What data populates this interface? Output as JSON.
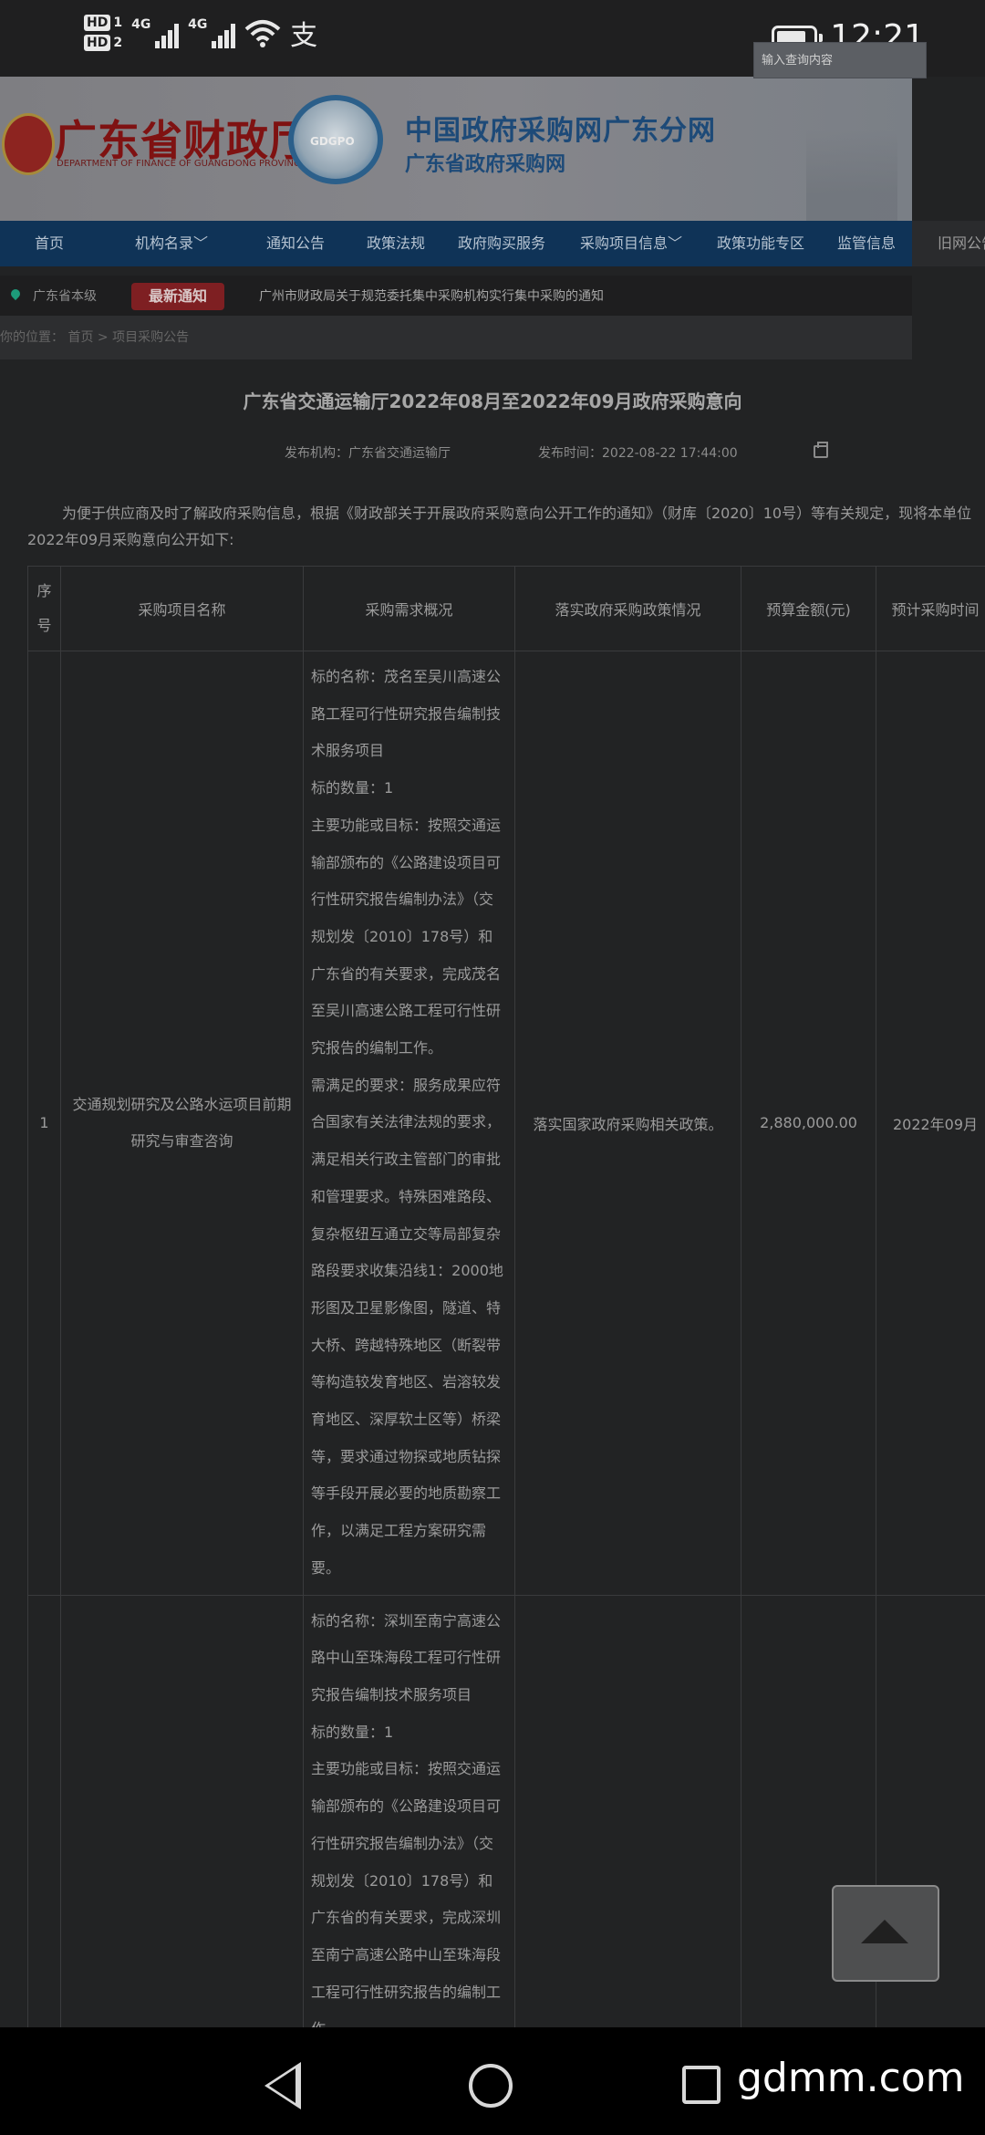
{
  "status_bar": {
    "sim1": "HD",
    "sim1_num": "1",
    "sim2": "HD",
    "sim2_num": "2",
    "network1": "4G",
    "network2": "4G",
    "extra_icon": "支",
    "battery_level": 0.8,
    "time": "12:21"
  },
  "header": {
    "logo_text": "广东省财政厅",
    "logo_sub": "DEPARTMENT OF FINANCE OF GUANGDONG PROVINCE",
    "badge_text": "GDGPO",
    "site_title": "中国政府采购网广东分网",
    "site_subtitle": "广东省政府采购网",
    "search_placeholder": "输入查询内容"
  },
  "nav": {
    "items": [
      {
        "label": "首页"
      },
      {
        "label": "机构名录﹀"
      },
      {
        "label": "通知公告"
      },
      {
        "label": "政策法规"
      },
      {
        "label": "政府购买服务"
      },
      {
        "label": "采购项目信息﹀"
      },
      {
        "label": "政策功能专区"
      },
      {
        "label": "监管信息"
      },
      {
        "label": "旧网公告"
      }
    ]
  },
  "notice": {
    "region": "广东省本级",
    "badge": "最新通知",
    "text": "广州市财政局关于规范委托集中采购机构实行集中采购的通知"
  },
  "breadcrumb": {
    "text": "你的位置： 首页 > 项目采购公告"
  },
  "article": {
    "title": "广东省交通运输厅2022年08月至2022年09月政府采购意向",
    "publisher": "发布机构：广东省交通运输厅",
    "publish_time": "发布时间：2022-08-22 17:44:00",
    "intro": "为便于供应商及时了解政府采购信息，根据《财政部关于开展政府采购意向公开工作的通知》（财库〔2020〕10号）等有关规定，现将本单位2022年09月采购意向公开如下:"
  },
  "table": {
    "headers": [
      "序号",
      "采购项目名称",
      "采购需求概况",
      "落实政府采购政策情况",
      "预算金额(元)",
      "预计采购时间"
    ],
    "rows": [
      {
        "index": "1",
        "name": "交通规划研究及公路水运项目前期研究与审查咨询",
        "requirement": "标的名称：茂名至吴川高速公路工程可行性研究报告编制技术服务项目\n标的数量：1\n主要功能或目标：按照交通运输部颁布的《公路建设项目可行性研究报告编制办法》（交规划发〔2010〕178号）和广东省的有关要求，完成茂名至吴川高速公路工程可行性研究报告的编制工作。\n需满足的要求：服务成果应符合国家有关法律法规的要求，满足相关行政主管部门的审批和管理要求。特殊困难路段、复杂枢纽互通立交等局部复杂路段要求收集沿线1：2000地形图及卫星影像图，隧道、特大桥、跨越特殊地区（断裂带等构造较发育地区、岩溶较发育地区、深厚软土区等）桥梁等，要求通过物探或地质钻探等手段开展必要的地质勘察工作，以满足工程方案研究需要。",
        "policy": "落实国家政府采购相关政策。",
        "budget": "2,880,000.00",
        "time": "2022年09月"
      },
      {
        "index": "",
        "name": "",
        "requirement": "标的名称：深圳至南宁高速公路中山至珠海段工程可行性研究报告编制技术服务项目\n标的数量：1\n主要功能或目标：按照交通运输部颁布的《公路建设项目可行性研究报告编制办法》（交规划发〔2010〕178号）和广东省的有关要求，完成深圳至南宁高速公路中山至珠海段工程可行性研究报告的编制工作。",
        "policy": "",
        "budget": "",
        "time": ""
      }
    ]
  },
  "watermark": "gdmm.com"
}
